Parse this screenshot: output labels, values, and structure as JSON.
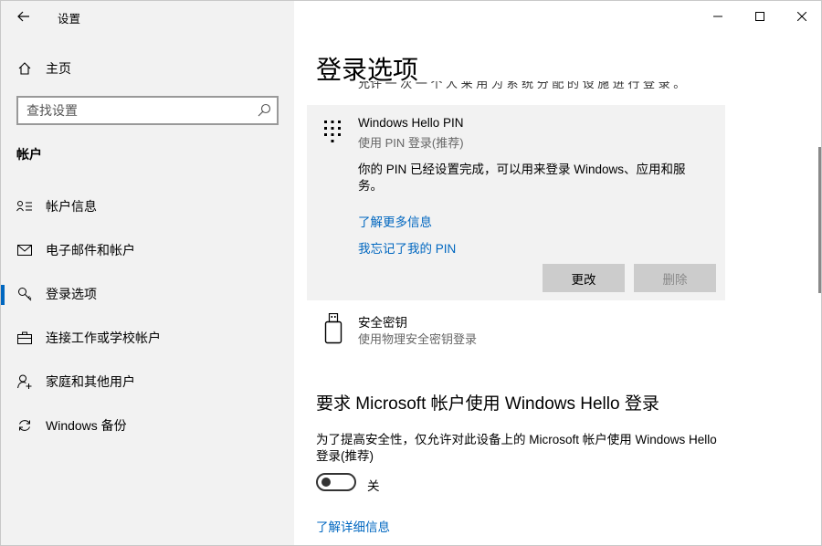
{
  "sidebar": {
    "app_title": "设置",
    "home_label": "主页",
    "search_placeholder": "查找设置",
    "section_header": "帐户",
    "items": [
      {
        "label": "帐户信息",
        "icon": "account-info-icon"
      },
      {
        "label": "电子邮件和帐户",
        "icon": "mail-icon"
      },
      {
        "label": "登录选项",
        "icon": "key-icon",
        "selected": true
      },
      {
        "label": "连接工作或学校帐户",
        "icon": "briefcase-icon"
      },
      {
        "label": "家庭和其他用户",
        "icon": "add-person-icon"
      },
      {
        "label": "Windows 备份",
        "icon": "sync-icon"
      }
    ]
  },
  "main": {
    "page_title": "登录选项",
    "cut_text": "允许 一 次 一 个 人 来 用 为 系 统 分 配 的 设 施 进 行 登 录 。",
    "pin_card": {
      "title": "Windows Hello PIN",
      "subtitle": "使用 PIN 登录(推荐)",
      "description": "你的 PIN 已经设置完成，可以用来登录 Windows、应用和服务。",
      "link_more": "了解更多信息",
      "link_forgot": "我忘记了我的 PIN",
      "btn_change": "更改",
      "btn_remove": "删除"
    },
    "security_key": {
      "title": "安全密钥",
      "subtitle": "使用物理安全密钥登录"
    },
    "hello_section": {
      "title": "要求 Microsoft 帐户使用 Windows Hello 登录",
      "description": "为了提高安全性，仅允许对此设备上的 Microsoft 帐户使用 Windows Hello 登录(推荐)",
      "toggle_state": "关",
      "link_details": "了解详细信息"
    }
  },
  "colors": {
    "accent": "#0067c0",
    "sidebar_bg": "#f2f2f2",
    "card_bg": "#f2f2f2"
  }
}
